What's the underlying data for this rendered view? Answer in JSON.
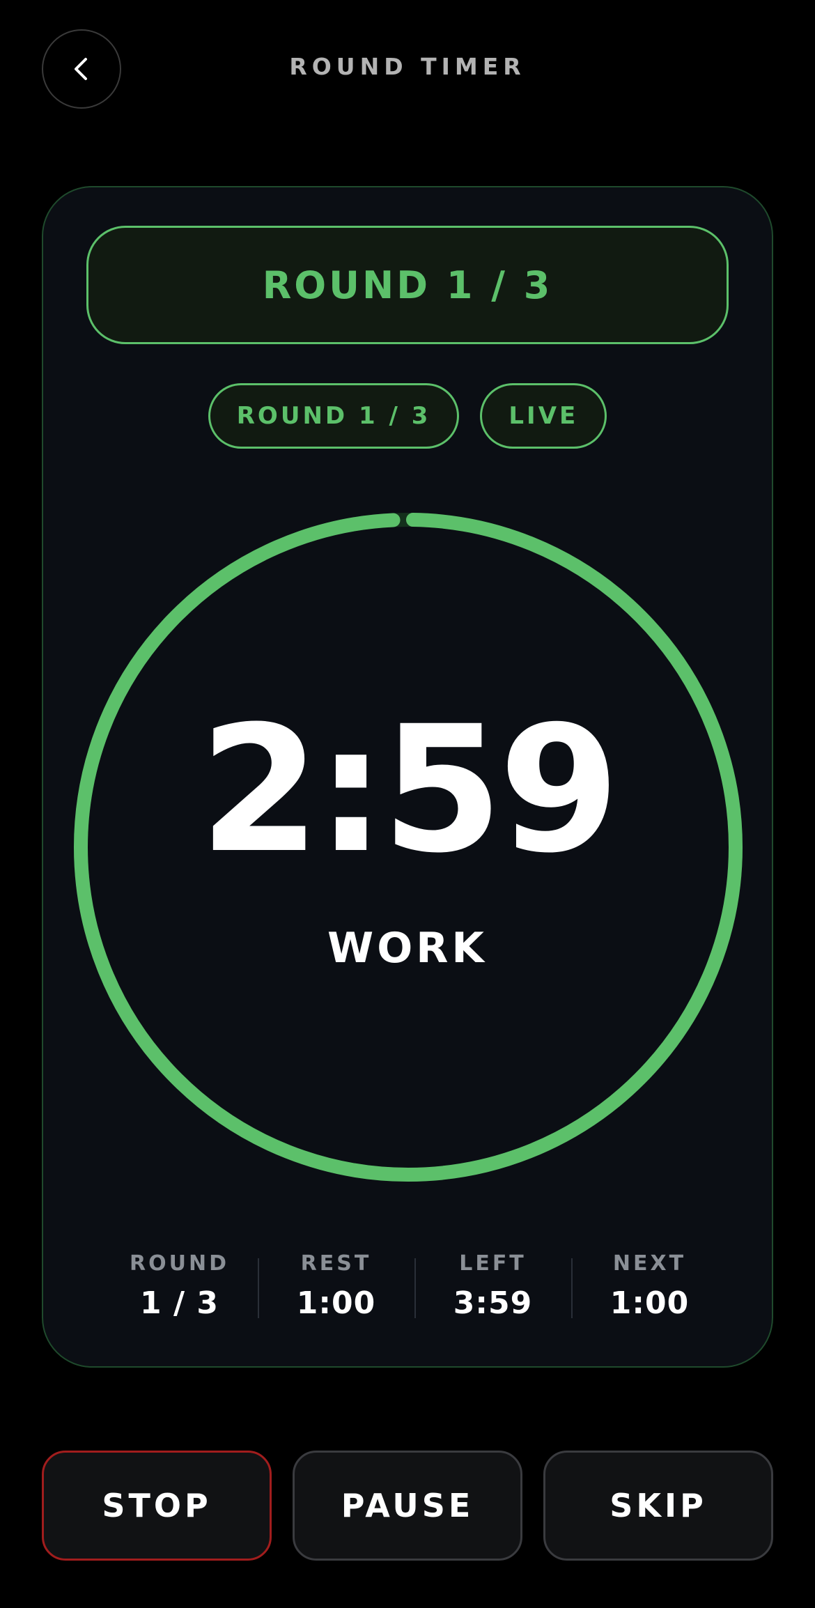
{
  "header": {
    "title": "ROUND TIMER",
    "back_icon": "chevron-left-icon"
  },
  "card": {
    "banner": "ROUND 1 / 3",
    "pills": {
      "round": "ROUND 1 / 3",
      "status": "LIVE"
    },
    "timer": {
      "time": "2:59",
      "phase": "WORK",
      "progress": 0.995,
      "ring_color": "#5cc06a"
    },
    "stats": [
      {
        "label": "ROUND",
        "value": "1 / 3"
      },
      {
        "label": "REST",
        "value": "1:00"
      },
      {
        "label": "LEFT",
        "value": "3:59"
      },
      {
        "label": "NEXT",
        "value": "1:00"
      }
    ]
  },
  "controls": {
    "stop": "STOP",
    "pause": "PAUSE",
    "skip": "SKIP"
  },
  "colors": {
    "accent": "#5cc06a",
    "stop_border": "#a11d1d",
    "background": "#000000",
    "card": "#0b0e14"
  }
}
